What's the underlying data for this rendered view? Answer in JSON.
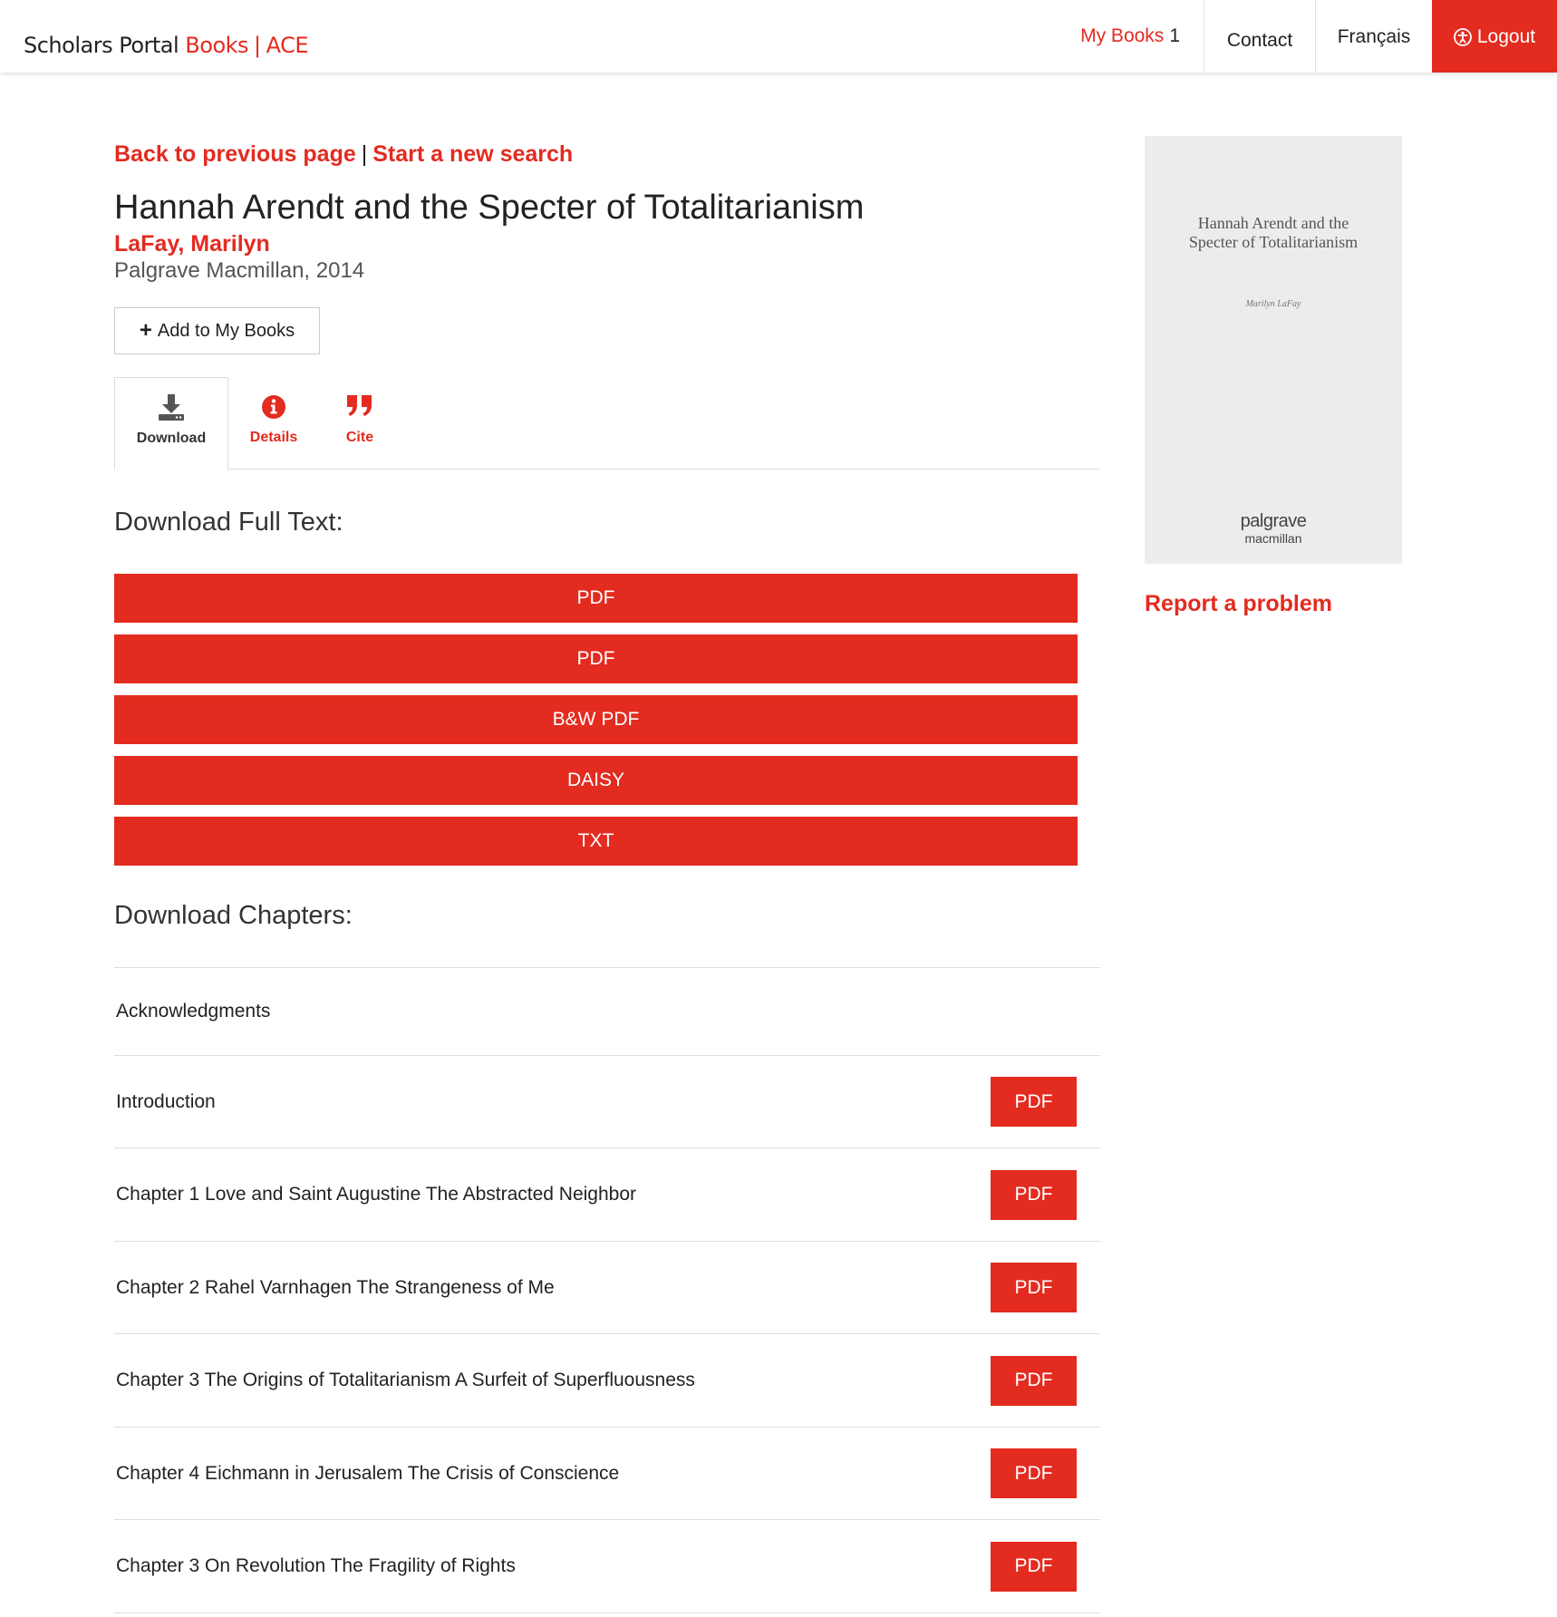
{
  "header": {
    "brand_part1": "Scholars Portal",
    "brand_part2": "Books",
    "brand_sep": "|",
    "brand_part3": "ACE",
    "nav": {
      "mybooks_label": "My Books",
      "mybooks_count": "1",
      "contact": "Contact",
      "language": "Français",
      "logout": "Logout"
    }
  },
  "breadcrumbs": {
    "back": "Back to previous page",
    "separator": "|",
    "new_search": "Start a new search"
  },
  "book": {
    "title": "Hannah Arendt and the Specter of Totalitarianism",
    "author": "LaFay, Marilyn",
    "publisher": "Palgrave Macmillan, 2014"
  },
  "add_button": {
    "icon": "plus-icon",
    "label": "Add to My Books"
  },
  "tabs": [
    {
      "icon": "download-icon",
      "label": "Download"
    },
    {
      "icon": "info-icon",
      "label": "Details"
    },
    {
      "icon": "quote-icon",
      "label": "Cite"
    }
  ],
  "full_text": {
    "heading": "Download Full Text:",
    "buttons": [
      "PDF",
      "PDF",
      "B&W PDF",
      "DAISY",
      "TXT"
    ]
  },
  "chapters": {
    "heading": "Download Chapters:",
    "items": [
      {
        "title": "Acknowledgments",
        "button": ""
      },
      {
        "title": "Introduction",
        "button": "PDF"
      },
      {
        "title": "Chapter 1 Love and Saint Augustine The Abstracted Neighbor",
        "button": "PDF"
      },
      {
        "title": "Chapter 2 Rahel Varnhagen The Strangeness of Me",
        "button": "PDF"
      },
      {
        "title": "Chapter 3 The Origins of Totalitarianism A Surfeit of Superfluousness",
        "button": "PDF"
      },
      {
        "title": "Chapter 4 Eichmann in Jerusalem The Crisis of Conscience",
        "button": "PDF"
      },
      {
        "title": "Chapter 3 On Revolution The Fragility of Rights",
        "button": "PDF"
      }
    ]
  },
  "cover": {
    "title_line1": "Hannah Arendt and the",
    "title_line2": "Specter of Totalitarianism",
    "author": "Marilyn LaFay",
    "logo_line1": "palgrave",
    "logo_line2": "macmillan"
  },
  "report": "Report a problem",
  "colors": {
    "accent": "#e32b20",
    "text": "#222222",
    "divider": "#dddddd"
  }
}
